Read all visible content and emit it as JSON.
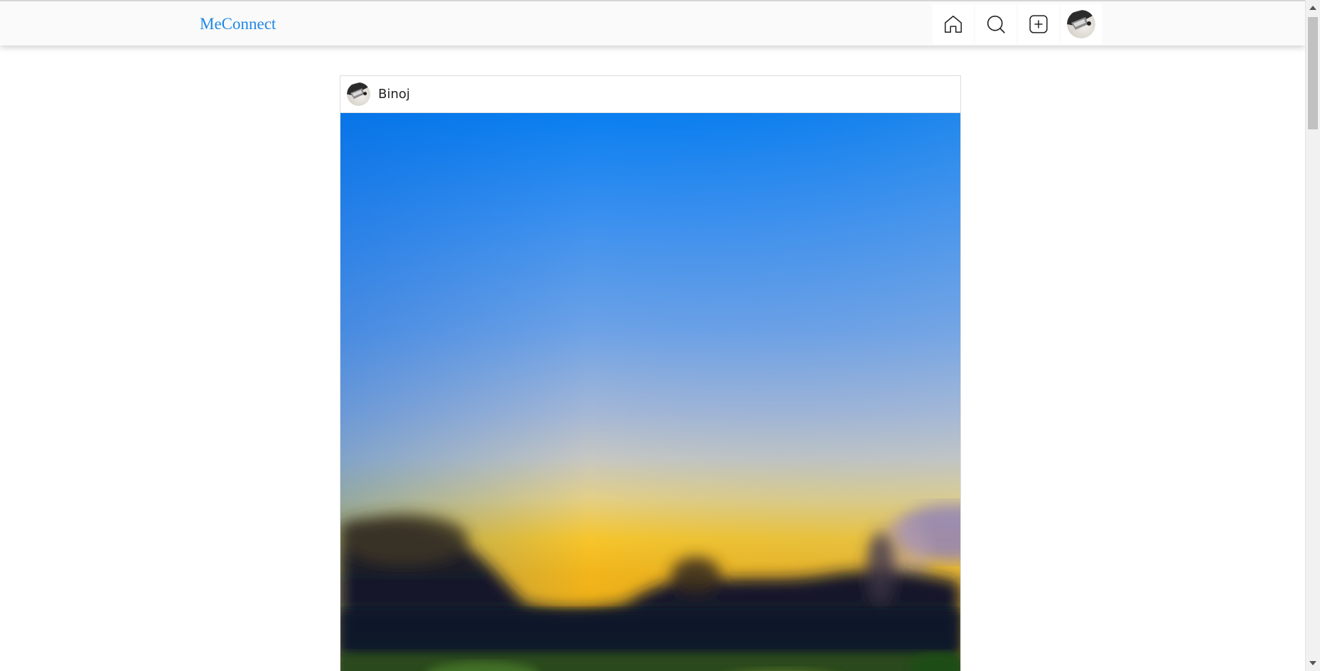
{
  "app": {
    "brand": "MeConnect",
    "brand_color": "#1e88e5"
  },
  "nav": {
    "icons": [
      "home-icon",
      "search-icon",
      "plus-square-icon",
      "avatar"
    ]
  },
  "post": {
    "username": "Binoj",
    "image_description_icon": "photo"
  }
}
